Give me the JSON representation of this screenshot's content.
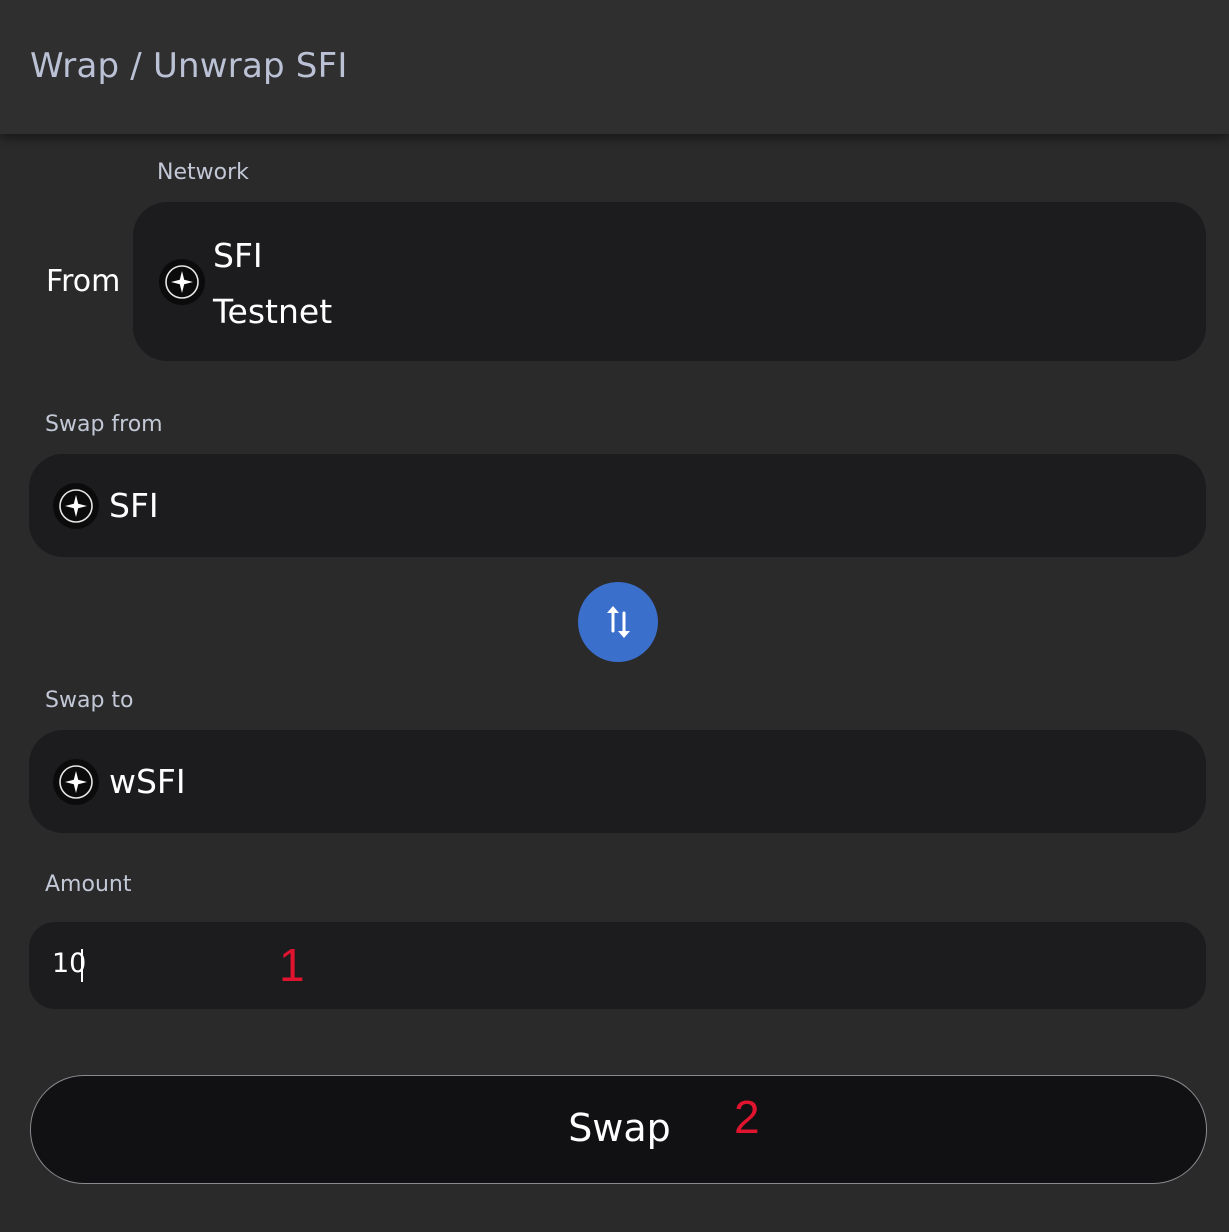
{
  "header": {
    "title": "Wrap / Unwrap SFI"
  },
  "network": {
    "label": "Network",
    "from_label": "From",
    "name_line1": "SFI",
    "name_line2": "Testnet",
    "icon": "sfi-star-icon"
  },
  "swap_from": {
    "label": "Swap from",
    "token": "SFI",
    "icon": "sfi-star-icon"
  },
  "swap_direction": {
    "icon": "swap-arrows-icon",
    "color": "#3b6fcc"
  },
  "swap_to": {
    "label": "Swap to",
    "token": "wSFI",
    "icon": "sfi-star-icon"
  },
  "amount": {
    "label": "Amount",
    "value": "10"
  },
  "annotations": {
    "first": "1",
    "second": "2",
    "color": "#e0142f"
  },
  "swap_button": {
    "label": "Swap"
  }
}
